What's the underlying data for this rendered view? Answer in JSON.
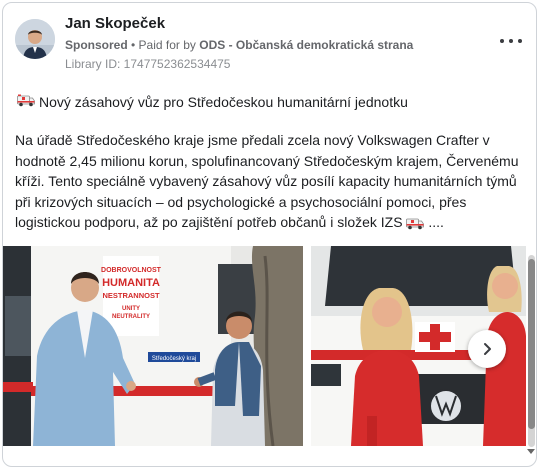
{
  "post": {
    "author": "Jan Skopeček",
    "sponsored": "Sponsored",
    "paid_prefix": "• Paid for by",
    "paid_by": "ODS - Občanská demokratická strana",
    "library_id": "Library ID: 1747752362534475",
    "headline": "Nový zásahový vůz pro Středočeskou humanitární jednotku",
    "body": "Na úřadě Středočeského kraje jsme předali zcela nový Volkswagen Crafter v hodnotě 2,45 milionu korun, spolufinancovaný Středočeským krajem, Červenému kříži. Tento speciálně vybavený zásahový vůz posílí kapacity humanitárních týmů při krizových situacích – od psychologické a psychosociální pomoci, přes logistickou podporu, až po zajištění potřeb občanů i složek IZS",
    "body_suffix": "....",
    "icons": {
      "headline_emoji": "ambulance-icon",
      "body_emoji": "ambulance-icon",
      "more": "more-dots-icon",
      "next": "chevron-right-icon"
    }
  },
  "van_text": {
    "lines": [
      "DOBROVOLNOST",
      "HUMANITA",
      "NESTRANNOST",
      "UNITY",
      "NEUTRALITY"
    ],
    "strip": "Středočeský kraj"
  },
  "colors": {
    "accent_red": "#d32a2a",
    "text_primary": "#1c1e21",
    "text_secondary": "#65676b"
  }
}
